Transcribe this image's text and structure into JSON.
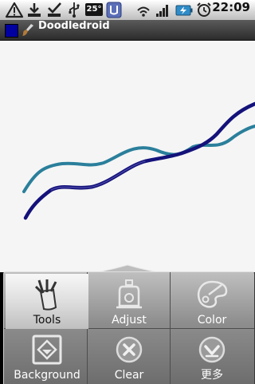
{
  "status_bar": {
    "icons": [
      "warning-icon",
      "download-icon",
      "check-icon",
      "usb-icon",
      "temperature-badge",
      "app-notification-icon",
      "wifi-icon",
      "signal-icon",
      "battery-charging-icon",
      "alarm-icon"
    ],
    "temperature": "25°",
    "time": "22:09"
  },
  "title_bar": {
    "title": "Doodledroid",
    "current_color": "#0000a0",
    "icon": "paintbrush-icon"
  },
  "canvas": {
    "background": "#f5f5f5",
    "strokes": [
      {
        "name": "teal-stroke",
        "color": "#2a7f9b"
      },
      {
        "name": "navy-stroke",
        "color": "#14127a"
      }
    ]
  },
  "menu": {
    "items": [
      {
        "label": "Tools",
        "icon": "tools-icon",
        "selected": true
      },
      {
        "label": "Adjust",
        "icon": "adjust-icon",
        "selected": false
      },
      {
        "label": "Color",
        "icon": "palette-icon",
        "selected": false
      },
      {
        "label": "Background",
        "icon": "background-icon",
        "selected": false
      },
      {
        "label": "Clear",
        "icon": "clear-icon",
        "selected": false
      },
      {
        "label": "更多",
        "icon": "more-icon",
        "selected": false
      }
    ]
  }
}
